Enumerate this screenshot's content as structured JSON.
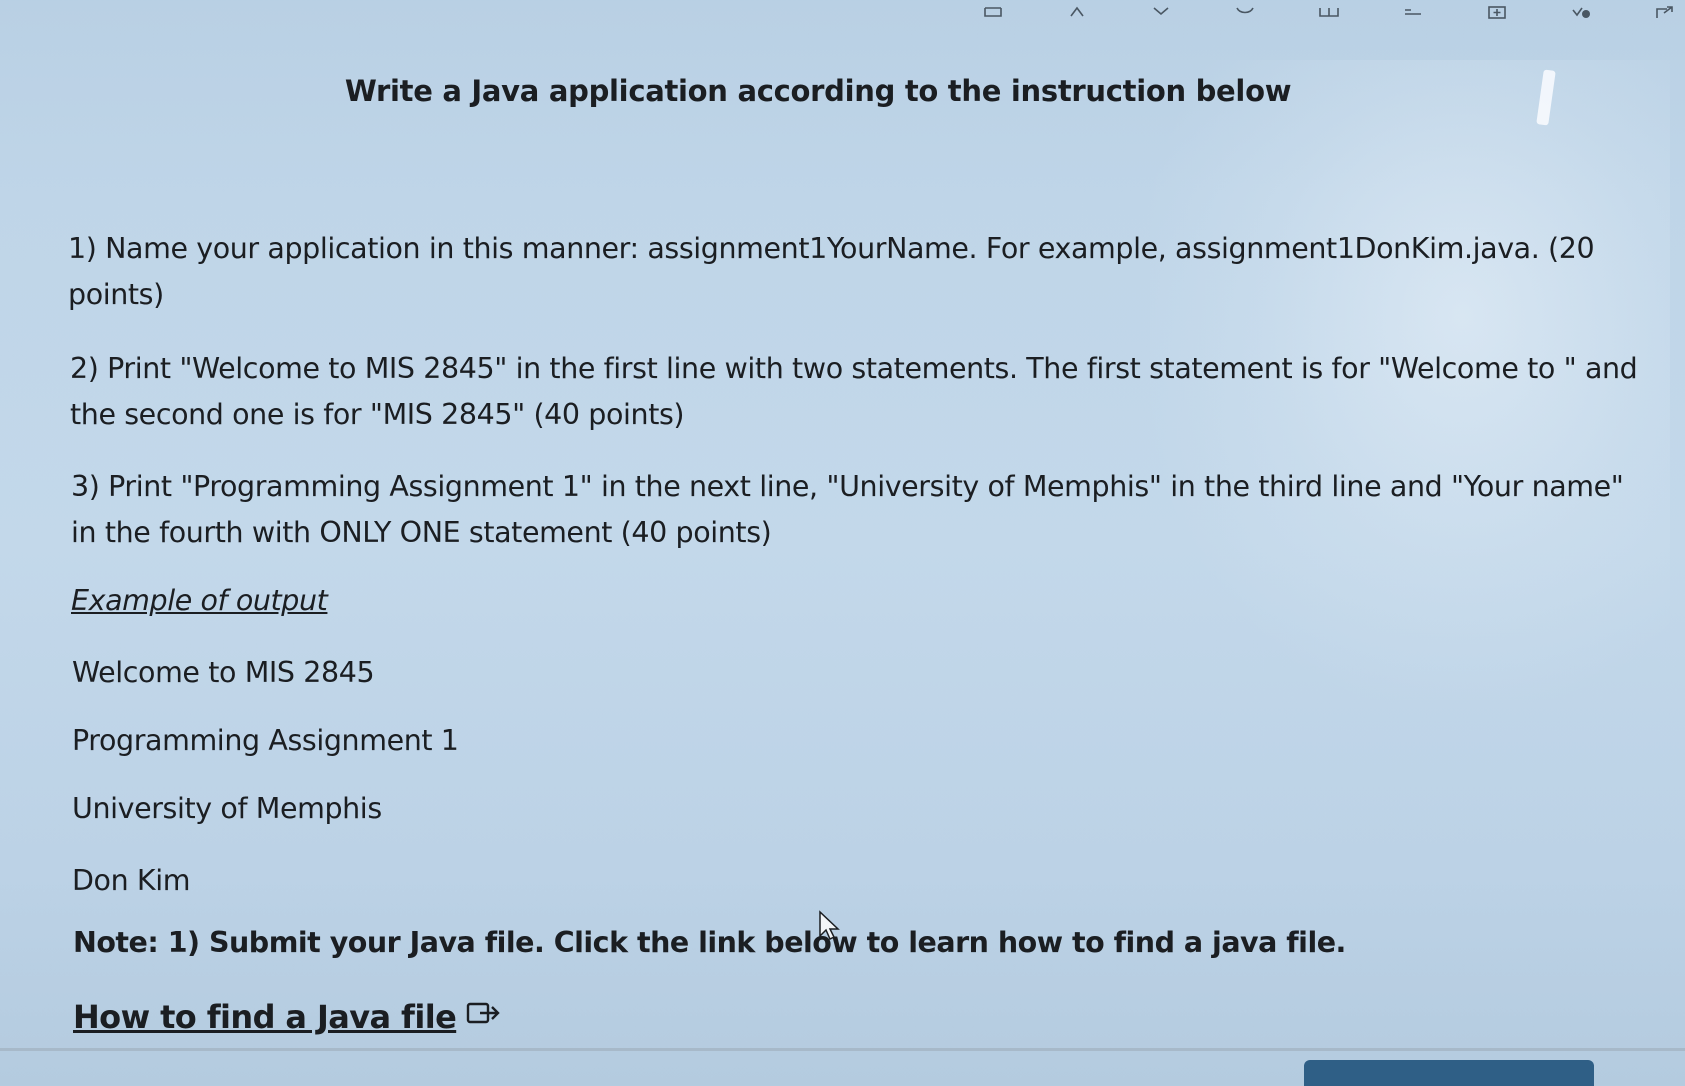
{
  "toolbar": {
    "icons": [
      "table-icon",
      "sort-icon",
      "star-icon",
      "puzzle-icon",
      "split-icon",
      "list-icon",
      "add-tab-icon",
      "extension-icon",
      "share-icon"
    ]
  },
  "title": "Write a Java application according to the instruction below",
  "items": [
    "1) Name your application in this manner: assignment1YourName. For example, assignment1DonKim.java. (20 points)",
    "2) Print \"Welcome to MIS 2845\" in the first line with two statements. The first statement is for \"Welcome to \" and the second one is for \"MIS 2845\" (40 points)",
    "3) Print \"Programming Assignment 1\" in the next line, \"University of Memphis\" in the third line and \"Your name\" in the fourth with ONLY ONE statement (40 points)"
  ],
  "example_heading": "Example of output",
  "output_lines": [
    "Welcome to MIS 2845",
    "Programming Assignment 1",
    "University of Memphis",
    "Don Kim"
  ],
  "note": "Note: 1) Submit your Java file. Click the link below to learn how to find a java file.",
  "link": {
    "text": "How to find a Java file",
    "icon": "external-link-icon"
  },
  "colors": {
    "background": "#bfd5e8",
    "text": "#1b1e22",
    "button": "#2f5f86"
  }
}
